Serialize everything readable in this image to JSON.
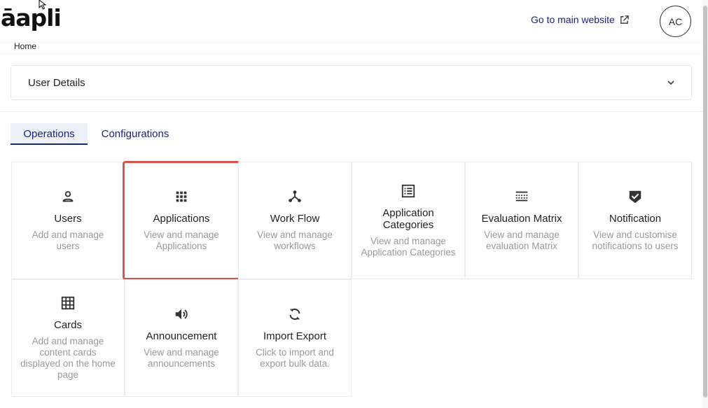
{
  "header": {
    "logo_text": "āapli",
    "main_link_label": "Go to main website",
    "avatar_initials": "AC"
  },
  "breadcrumb": {
    "home": "Home"
  },
  "accordion": {
    "title": "User Details",
    "icon": "chevron-down-icon"
  },
  "tabs": [
    {
      "label": "Operations",
      "active": true
    },
    {
      "label": "Configurations",
      "active": false
    }
  ],
  "cards": [
    {
      "title": "Users",
      "desc": "Add and manage users",
      "icon": "user-icon"
    },
    {
      "title": "Applications",
      "desc": "View and manage Applications",
      "icon": "apps-grid-icon",
      "selected": true
    },
    {
      "title": "Work Flow",
      "desc": "View and manage workflows",
      "icon": "workflow-icon"
    },
    {
      "title": "Application Categories",
      "desc": "View and manage Application Categories",
      "icon": "list-icon"
    },
    {
      "title": "Evaluation Matrix",
      "desc": "View and manage evaluation Matrix",
      "icon": "matrix-icon"
    },
    {
      "title": "Notification",
      "desc": "View and customise notifications to users",
      "icon": "shield-check-icon"
    },
    {
      "title": "Cards",
      "desc": "Add and manage content cards displayed on the home page",
      "icon": "table-grid-icon"
    },
    {
      "title": "Announcement",
      "desc": "View and manage announcements",
      "icon": "speaker-icon"
    },
    {
      "title": "Import Export",
      "desc": "Click to import and export bulk data.",
      "icon": "sync-icon"
    }
  ],
  "colors": {
    "accent": "#1a237e",
    "selected_border": "#d9534f",
    "muted_text": "#9a9a9a"
  }
}
